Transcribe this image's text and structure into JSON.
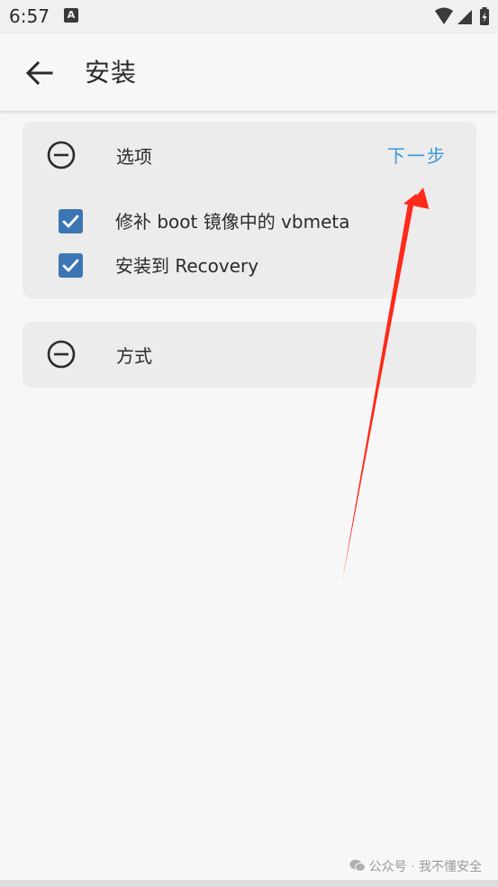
{
  "status_bar": {
    "time": "6:57",
    "app_badge": "A",
    "icons": [
      "wifi-icon",
      "cellular-icon",
      "battery-charging-icon"
    ]
  },
  "app_bar": {
    "title": "安装",
    "back_icon": "arrow-back-icon"
  },
  "options_card": {
    "title": "选项",
    "next_label": "下一步",
    "collapse_icon": "minus-circle-icon",
    "items": [
      {
        "label": "修补 boot 镜像中的 vbmeta",
        "checked": true
      },
      {
        "label": "安装到 Recovery",
        "checked": true
      }
    ]
  },
  "method_card": {
    "title": "方式",
    "collapse_icon": "minus-circle-icon"
  },
  "annotation": {
    "type": "arrow",
    "color": "#ff2a1a"
  },
  "watermark": {
    "text": "公众号 · 我不懂安全"
  },
  "colors": {
    "accent": "#3d96d8",
    "checkbox": "#3c75b3",
    "card_bg": "#ececec",
    "page_bg": "#f7f7f7"
  }
}
